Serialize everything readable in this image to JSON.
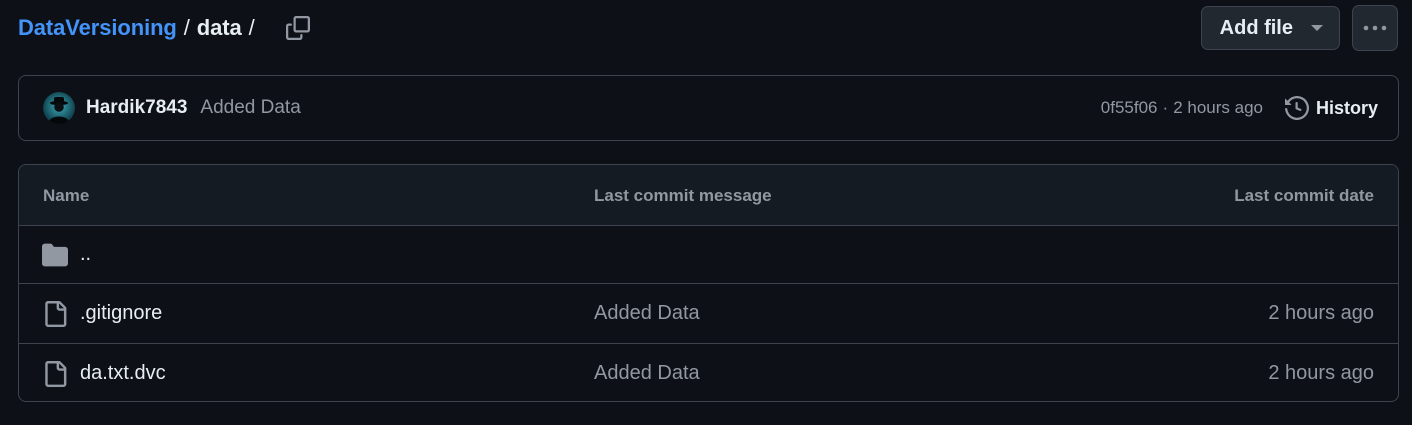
{
  "breadcrumb": {
    "repo": "DataVersioning",
    "separator": "/",
    "folder": "data",
    "trailing_separator": "/"
  },
  "actions": {
    "add_file_label": "Add file",
    "more_icon": "kebab-horizontal-icon",
    "copy_icon": "copy-icon"
  },
  "latest_commit": {
    "author": "Hardik7843",
    "message": "Added Data",
    "sha": "0f55f06",
    "separator": "·",
    "time": "2 hours ago",
    "history_label": "History"
  },
  "table": {
    "headers": {
      "name": "Name",
      "message": "Last commit message",
      "date": "Last commit date"
    },
    "parent_dir": {
      "name": "..",
      "icon": "folder-icon"
    },
    "files": [
      {
        "name": ".gitignore",
        "message": "Added Data",
        "date": "2 hours ago",
        "icon": "file-icon"
      },
      {
        "name": "da.txt.dvc",
        "message": "Added Data",
        "date": "2 hours ago",
        "icon": "file-icon"
      }
    ]
  },
  "colors": {
    "background": "#0d1117",
    "link": "#4493f8",
    "border": "#3d444d",
    "muted_text": "#9198a1",
    "header_bg": "#151b23",
    "button_bg": "#212830"
  }
}
